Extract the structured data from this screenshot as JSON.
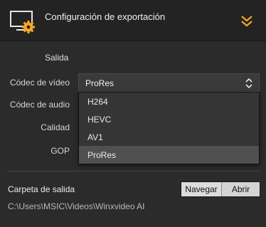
{
  "header": {
    "title": "Configuración de exportación"
  },
  "section": {
    "title": "Salida"
  },
  "form": {
    "video_codec_label": "Códec de vídeo",
    "audio_codec_label": "Códec de audio",
    "quality_label": "Calidad",
    "gop_label": "GOP",
    "video_codec_value": "ProRes",
    "video_codec_options": [
      "H264",
      "HEVC",
      "AV1",
      "ProRes"
    ],
    "selected_option_index": 3
  },
  "output": {
    "folder_label": "Carpeta de salida",
    "path": "C:\\Users\\MSIC\\Videos\\Winxvideo AI",
    "browse_label": "Navegar",
    "open_label": "Abrir"
  },
  "colors": {
    "accent": "#f5a623",
    "background": "#2b2b2b",
    "header_background": "#232323",
    "selected_option": "#505050"
  },
  "icons": {
    "header": "monitor-gear-icon",
    "collapse": "double-chevron-down-icon",
    "select": "chevron-updown-icon"
  }
}
